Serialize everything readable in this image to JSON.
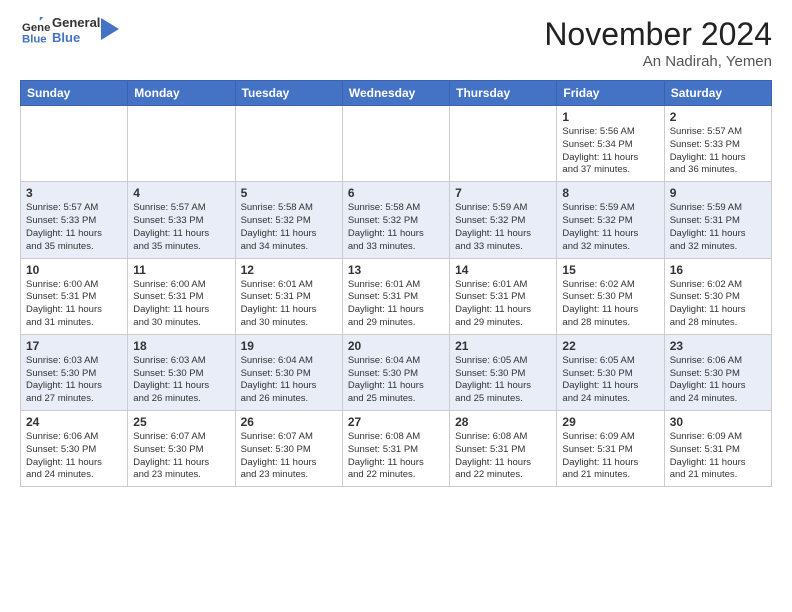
{
  "logo": {
    "general": "General",
    "blue": "Blue"
  },
  "title": "November 2024",
  "subtitle": "An Nadirah, Yemen",
  "days_of_week": [
    "Sunday",
    "Monday",
    "Tuesday",
    "Wednesday",
    "Thursday",
    "Friday",
    "Saturday"
  ],
  "weeks": [
    [
      {
        "num": "",
        "info": ""
      },
      {
        "num": "",
        "info": ""
      },
      {
        "num": "",
        "info": ""
      },
      {
        "num": "",
        "info": ""
      },
      {
        "num": "",
        "info": ""
      },
      {
        "num": "1",
        "info": "Sunrise: 5:56 AM\nSunset: 5:34 PM\nDaylight: 11 hours\nand 37 minutes."
      },
      {
        "num": "2",
        "info": "Sunrise: 5:57 AM\nSunset: 5:33 PM\nDaylight: 11 hours\nand 36 minutes."
      }
    ],
    [
      {
        "num": "3",
        "info": "Sunrise: 5:57 AM\nSunset: 5:33 PM\nDaylight: 11 hours\nand 35 minutes."
      },
      {
        "num": "4",
        "info": "Sunrise: 5:57 AM\nSunset: 5:33 PM\nDaylight: 11 hours\nand 35 minutes."
      },
      {
        "num": "5",
        "info": "Sunrise: 5:58 AM\nSunset: 5:32 PM\nDaylight: 11 hours\nand 34 minutes."
      },
      {
        "num": "6",
        "info": "Sunrise: 5:58 AM\nSunset: 5:32 PM\nDaylight: 11 hours\nand 33 minutes."
      },
      {
        "num": "7",
        "info": "Sunrise: 5:59 AM\nSunset: 5:32 PM\nDaylight: 11 hours\nand 33 minutes."
      },
      {
        "num": "8",
        "info": "Sunrise: 5:59 AM\nSunset: 5:32 PM\nDaylight: 11 hours\nand 32 minutes."
      },
      {
        "num": "9",
        "info": "Sunrise: 5:59 AM\nSunset: 5:31 PM\nDaylight: 11 hours\nand 32 minutes."
      }
    ],
    [
      {
        "num": "10",
        "info": "Sunrise: 6:00 AM\nSunset: 5:31 PM\nDaylight: 11 hours\nand 31 minutes."
      },
      {
        "num": "11",
        "info": "Sunrise: 6:00 AM\nSunset: 5:31 PM\nDaylight: 11 hours\nand 30 minutes."
      },
      {
        "num": "12",
        "info": "Sunrise: 6:01 AM\nSunset: 5:31 PM\nDaylight: 11 hours\nand 30 minutes."
      },
      {
        "num": "13",
        "info": "Sunrise: 6:01 AM\nSunset: 5:31 PM\nDaylight: 11 hours\nand 29 minutes."
      },
      {
        "num": "14",
        "info": "Sunrise: 6:01 AM\nSunset: 5:31 PM\nDaylight: 11 hours\nand 29 minutes."
      },
      {
        "num": "15",
        "info": "Sunrise: 6:02 AM\nSunset: 5:30 PM\nDaylight: 11 hours\nand 28 minutes."
      },
      {
        "num": "16",
        "info": "Sunrise: 6:02 AM\nSunset: 5:30 PM\nDaylight: 11 hours\nand 28 minutes."
      }
    ],
    [
      {
        "num": "17",
        "info": "Sunrise: 6:03 AM\nSunset: 5:30 PM\nDaylight: 11 hours\nand 27 minutes."
      },
      {
        "num": "18",
        "info": "Sunrise: 6:03 AM\nSunset: 5:30 PM\nDaylight: 11 hours\nand 26 minutes."
      },
      {
        "num": "19",
        "info": "Sunrise: 6:04 AM\nSunset: 5:30 PM\nDaylight: 11 hours\nand 26 minutes."
      },
      {
        "num": "20",
        "info": "Sunrise: 6:04 AM\nSunset: 5:30 PM\nDaylight: 11 hours\nand 25 minutes."
      },
      {
        "num": "21",
        "info": "Sunrise: 6:05 AM\nSunset: 5:30 PM\nDaylight: 11 hours\nand 25 minutes."
      },
      {
        "num": "22",
        "info": "Sunrise: 6:05 AM\nSunset: 5:30 PM\nDaylight: 11 hours\nand 24 minutes."
      },
      {
        "num": "23",
        "info": "Sunrise: 6:06 AM\nSunset: 5:30 PM\nDaylight: 11 hours\nand 24 minutes."
      }
    ],
    [
      {
        "num": "24",
        "info": "Sunrise: 6:06 AM\nSunset: 5:30 PM\nDaylight: 11 hours\nand 24 minutes."
      },
      {
        "num": "25",
        "info": "Sunrise: 6:07 AM\nSunset: 5:30 PM\nDaylight: 11 hours\nand 23 minutes."
      },
      {
        "num": "26",
        "info": "Sunrise: 6:07 AM\nSunset: 5:30 PM\nDaylight: 11 hours\nand 23 minutes."
      },
      {
        "num": "27",
        "info": "Sunrise: 6:08 AM\nSunset: 5:31 PM\nDaylight: 11 hours\nand 22 minutes."
      },
      {
        "num": "28",
        "info": "Sunrise: 6:08 AM\nSunset: 5:31 PM\nDaylight: 11 hours\nand 22 minutes."
      },
      {
        "num": "29",
        "info": "Sunrise: 6:09 AM\nSunset: 5:31 PM\nDaylight: 11 hours\nand 21 minutes."
      },
      {
        "num": "30",
        "info": "Sunrise: 6:09 AM\nSunset: 5:31 PM\nDaylight: 11 hours\nand 21 minutes."
      }
    ]
  ]
}
